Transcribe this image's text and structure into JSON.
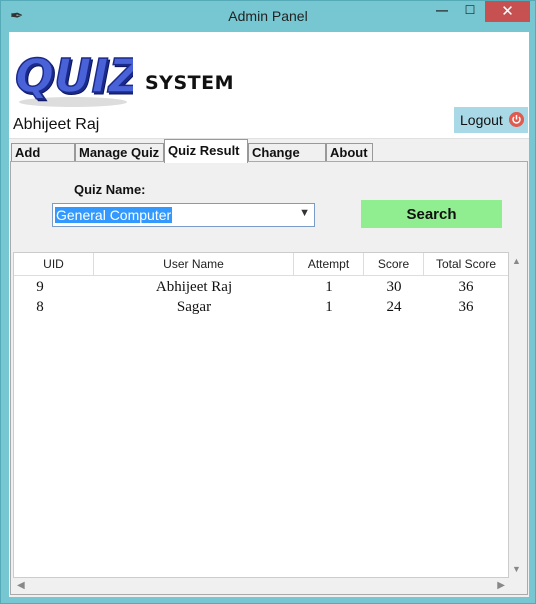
{
  "window": {
    "title": "Admin Panel",
    "minimize": "—",
    "maximize": "☐",
    "close": "✕"
  },
  "header": {
    "logo_text": "QUIZ!",
    "system_text": "SYSTEM",
    "user_name": "Abhijeet Raj",
    "logout_label": "Logout"
  },
  "tabs": [
    "Add Quiz",
    "Manage Quiz",
    "Quiz Result",
    "Change Pin",
    "About"
  ],
  "active_tab": "Quiz Result",
  "quiz_result": {
    "quiz_name_label": "Quiz Name:",
    "quiz_selected": "General Computer",
    "search_label": "Search",
    "columns": [
      "UID",
      "User Name",
      "Attempt",
      "Score",
      "Total Score"
    ],
    "rows": [
      [
        "9",
        "Abhijeet Raj",
        "1",
        "30",
        "36"
      ],
      [
        "8",
        "Sagar",
        "1",
        "24",
        "36"
      ]
    ]
  },
  "colors": {
    "search_button": "#90ee90",
    "logout_button": "#a9d8e6",
    "selection": "#3399ff",
    "close_button": "#c75050"
  }
}
